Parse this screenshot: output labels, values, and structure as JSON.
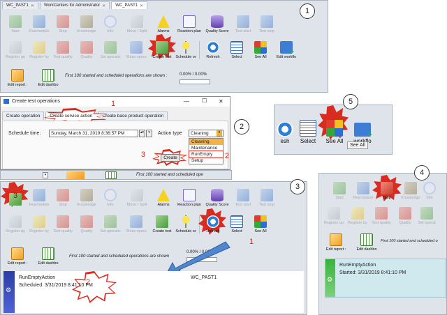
{
  "tabs": [
    {
      "label": "WC_PAST1",
      "active": false
    },
    {
      "label": "WorkCenters for Administrator",
      "active": false
    },
    {
      "label": "WC_PAST1",
      "active": true
    }
  ],
  "toolbar_row1": [
    {
      "key": "start",
      "label": "Start",
      "icon": "play-icon",
      "color": "green"
    },
    {
      "key": "reschedule",
      "label": "Reschedule",
      "icon": "pause-icon",
      "color": "blue"
    },
    {
      "key": "stop",
      "label": "Stop",
      "icon": "stop-icon",
      "color": "red"
    },
    {
      "key": "knowledge",
      "label": "Knowledge",
      "icon": "books-icon",
      "color": "books"
    },
    {
      "key": "info",
      "label": "Info",
      "icon": "info-icon",
      "color": "info"
    },
    {
      "key": "move",
      "label": "Move / Split",
      "icon": "move-icon",
      "color": "grey"
    },
    {
      "key": "alarms",
      "label": "Alarms",
      "icon": "warning-icon",
      "color": "warn"
    },
    {
      "key": "reaction",
      "label": "Reaction plan",
      "icon": "checklist-icon",
      "color": "check"
    },
    {
      "key": "quality",
      "label": "Quality Score",
      "icon": "database-icon",
      "color": "db"
    },
    {
      "key": "test_start",
      "label": "Test start",
      "icon": "play-icon",
      "color": "blue"
    },
    {
      "key": "test_stop",
      "label": "Test stop",
      "icon": "stop-icon",
      "color": "blue"
    }
  ],
  "toolbar_row2": [
    {
      "key": "register_qu",
      "label": "Register qu",
      "icon": "calculator-icon",
      "color": "grey"
    },
    {
      "key": "register_by",
      "label": "Register by",
      "icon": "coins-icon",
      "color": "yellow"
    },
    {
      "key": "test_quality",
      "label": "Test quality",
      "icon": "ribbon-icon",
      "color": "red"
    },
    {
      "key": "quality",
      "label": "Quality",
      "icon": "ribbon-icon",
      "color": "red"
    },
    {
      "key": "set_operatic",
      "label": "Set operatic",
      "icon": "flag-icon",
      "color": "green"
    },
    {
      "key": "show_opera",
      "label": "Show opera",
      "icon": "flow-icon",
      "color": "blue"
    },
    {
      "key": "create_test",
      "label": "Create test",
      "icon": "flag-check-icon",
      "color": "green"
    },
    {
      "key": "schedule_or",
      "label": "Schedule or",
      "icon": "pin-icon",
      "color": "pin"
    },
    {
      "key": "refresh",
      "label": "Refresh",
      "icon": "refresh-icon",
      "color": "refresh"
    },
    {
      "key": "select",
      "label": "Select",
      "icon": "calendar-icon",
      "color": "cal"
    },
    {
      "key": "see_all",
      "label": "See All",
      "icon": "cubes-icon",
      "color": "cubes"
    },
    {
      "key": "edit_workflo",
      "label": "Edit workflo",
      "icon": "add-icon",
      "color": "plus"
    }
  ],
  "row3": {
    "edit_report": "Edit report :",
    "edit_dashbo": "Edit dashbo",
    "status": "First 100 started and scheduled operations are shown :",
    "percent": "0.00% / 0.00%"
  },
  "dialog": {
    "title": "Create test operations",
    "tabs": [
      "Create operation",
      "Create service action",
      "Create base product operation"
    ],
    "schedule_label": "Schedule time:",
    "schedule_value": "Sunday, March 31, 2019 8:36:57 PM",
    "action_type_label": "Action type",
    "action_type_value": "Cleaning",
    "options": [
      "Cleaning",
      "Maintenance",
      "RunEmpty",
      "Setup"
    ],
    "create_button": "Create",
    "min_glyph": "—",
    "max_glyph": "☐",
    "close_glyph": "✕",
    "step1": "1",
    "step2": "2",
    "step3": "3"
  },
  "strip_status": "First 100 started and scheduled ope",
  "panel3": {
    "card_title": "RunEmptyAction",
    "card_scheduled": "Scheduled: 3/31/2019 8:41:10 PM",
    "workcenter": "WC_PAST1",
    "status": "First 100 started and scheduled operations are shown",
    "percent": "0.00% / 0.00%"
  },
  "panel4": {
    "status": "First 100 started and scheduled o",
    "card_title": "RunEmptyAction",
    "card_started": "Started: 3/31/2019 8:41:10 PM",
    "labels": [
      "Start",
      "Reschedule",
      "Stop",
      "Knowledge",
      "Info",
      "Register qu",
      "Register by",
      "Test quality",
      "Quality",
      "Set operat"
    ],
    "edit_report": "Edit report :",
    "edit_dashbo": "Edit dashbo"
  },
  "panel5": {
    "labels": [
      "esh",
      "Select",
      "See All",
      "workflo"
    ],
    "tooltip": "See All"
  },
  "badges": {
    "one": "1",
    "two": "2",
    "three": "3",
    "four": "4",
    "five": "5"
  },
  "colors": {
    "accent_red": "#d92b1f",
    "panel": "#dfe3ea",
    "card": "#cfe9ef"
  }
}
